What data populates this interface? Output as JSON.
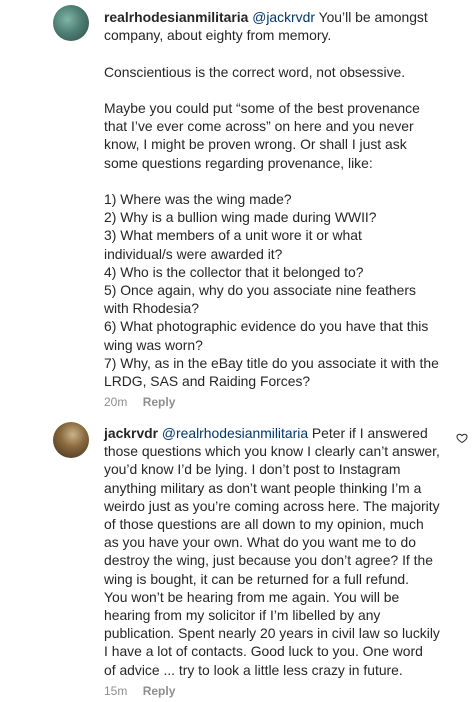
{
  "comments": [
    {
      "username": "realrhodesianmilitaria",
      "mention": "@jackrvdr",
      "text": " You’ll be amongst\ncompany, about eighty from memory.\n\nConscientious is the correct word, not obsessive.\n\nMaybe you could put “some of the best provenance\nthat I’ve ever come across” on here and you never\nknow, I might be proven wrong. Or shall I just ask\nsome questions regarding provenance, like:\n\n1) Where was the wing made?\n2) Why is a bullion wing made during WWII?\n3) What members of a unit wore it or what\nindividual/s were awarded it?\n4) Who is the collector that it belonged to?\n5) Once again, why do you associate nine feathers\nwith Rhodesia?\n6) What photographic evidence do you have that this\nwing was worn?\n7) Why, as in the eBay title do you associate it with the\nLRDG, SAS and Raiding Forces?",
      "time": "20m",
      "reply_label": "Reply",
      "avatar_icon": "user-avatar"
    },
    {
      "username": "jackrvdr",
      "mention": "@realrhodesianmilitaria",
      "text": " Peter if I answered\nthose questions which you know I clearly can’t answer,\nyou’d know I’d be lying. I don’t post to Instagram\nanything military as don’t want people thinking I’m a\nweirdo just as you’re coming across here. The majority\nof those questions are all down to my opinion, much\nas you have your own. What do you want me to do\ndestroy the wing, just because you don’t agree? If the\nwing is bought, it can be returned for a full refund.\nYou won’t be hearing from me again. You will be\nhearing from my solicitor if I’m libelled by any\npublication. Spent nearly 20 years in civil law so luckily\nI have a lot of contacts. Good luck to you. One word\nof advice ... try to look a little less crazy in future.",
      "time": "15m",
      "reply_label": "Reply",
      "avatar_icon": "user-avatar"
    }
  ],
  "colors": {
    "text": "#262626",
    "mention": "#00376b",
    "meta": "#8e8e8e"
  },
  "icons": {
    "like": "heart-outline-icon"
  }
}
